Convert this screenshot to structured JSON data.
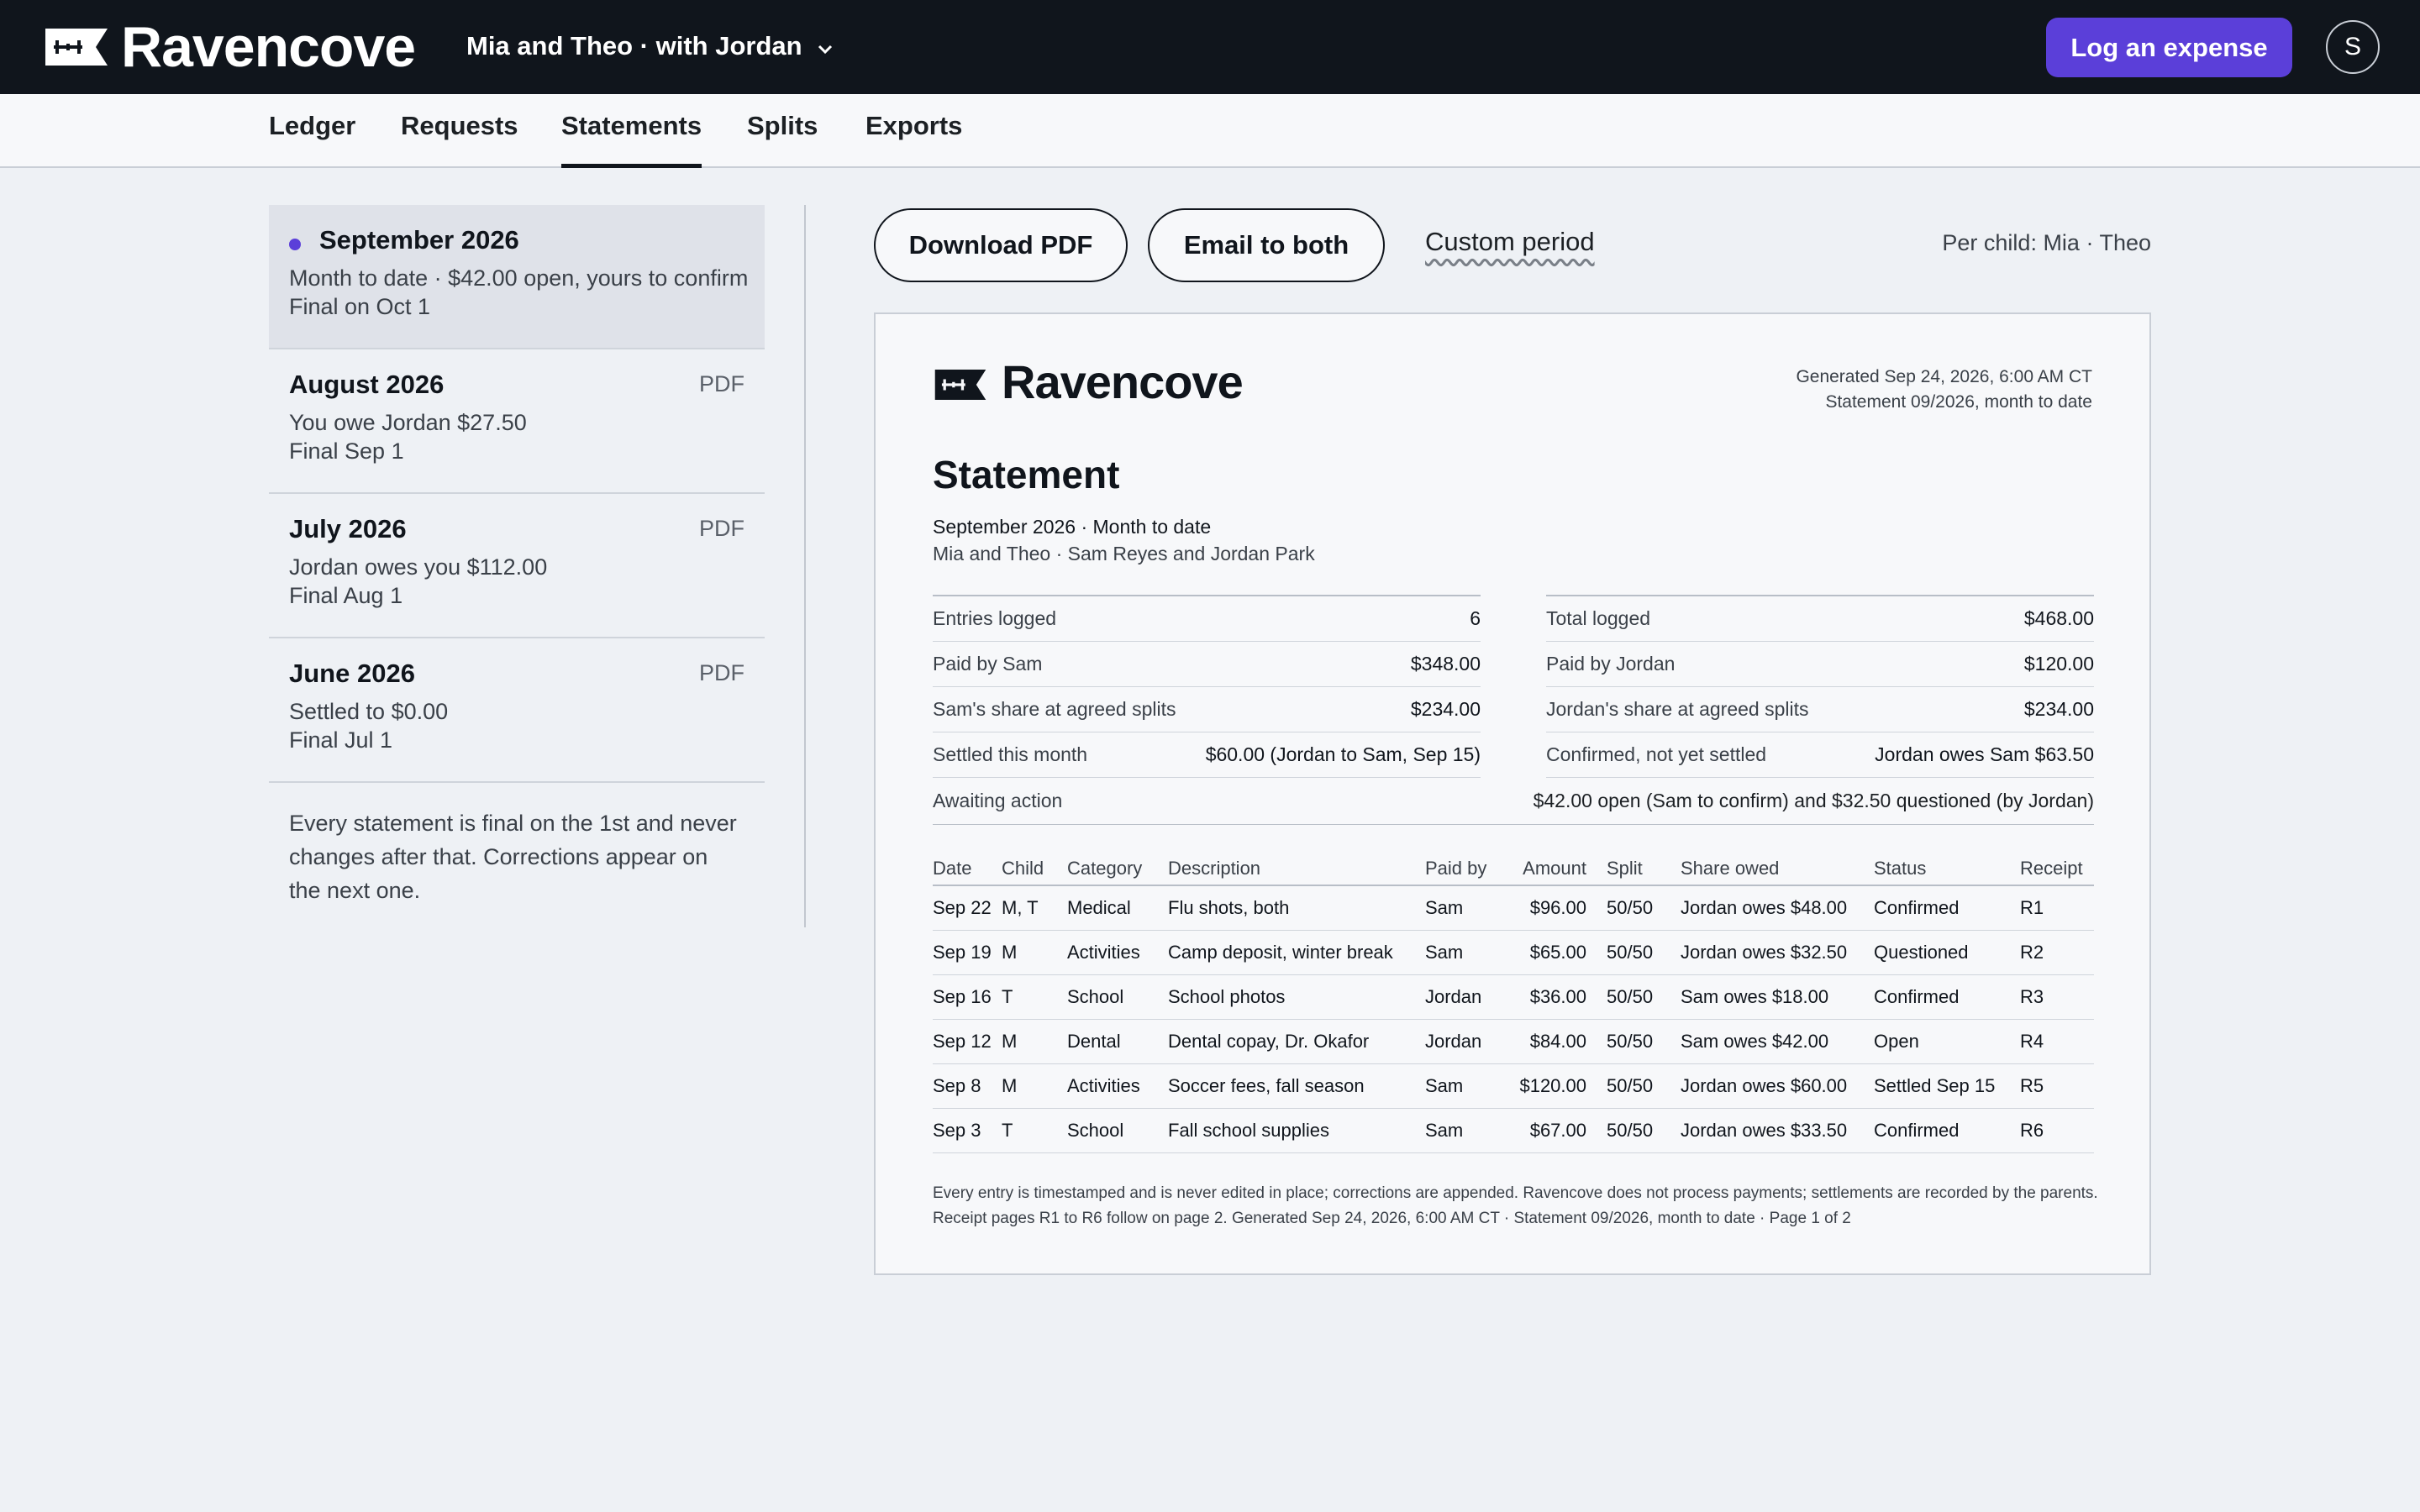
{
  "app": {
    "brand": "Ravencove"
  },
  "header": {
    "group_label": "Mia and Theo · with Jordan",
    "cta_label": "Log an expense",
    "avatar_initial": "S"
  },
  "tabs": [
    {
      "label": "Ledger",
      "active": false
    },
    {
      "label": "Requests",
      "active": false
    },
    {
      "label": "Statements",
      "active": true
    },
    {
      "label": "Splits",
      "active": false
    },
    {
      "label": "Exports",
      "active": false
    }
  ],
  "statements": [
    {
      "title": "September 2026",
      "line1": "Month to date · $42.00 open, yours to confirm",
      "line2": "Final on Oct 1",
      "tag": "",
      "active": true
    },
    {
      "title": "August 2026",
      "line1": "You owe Jordan $27.50",
      "line2": "Final Sep 1",
      "tag": "PDF",
      "active": false
    },
    {
      "title": "July 2026",
      "line1": "Jordan owes you $112.00",
      "line2": "Final Aug 1",
      "tag": "PDF",
      "active": false
    },
    {
      "title": "June 2026",
      "line1": "Settled to $0.00",
      "line2": "Final Jul 1",
      "tag": "PDF",
      "active": false
    }
  ],
  "statements_note": "Every statement is final on the 1st and never changes after that. Corrections appear on the next one.",
  "actions": {
    "download_label": "Download PDF",
    "email_label": "Email to both",
    "custom_period_label": "Custom period",
    "per_child_label": "Per child: Mia · Theo"
  },
  "document": {
    "brand": "Ravencove",
    "generated_line": "Generated Sep 24, 2026, 6:00 AM CT",
    "statement_line": "Statement 09/2026, month to date",
    "heading": "Statement",
    "period_line": "September 2026 · Month to date",
    "parties_line": "Mia and Theo · Sam Reyes and Jordan Park",
    "summary_left": [
      {
        "k": "Entries logged",
        "v": "6"
      },
      {
        "k": "Paid by Sam",
        "v": "$348.00"
      },
      {
        "k": "Sam's share at agreed splits",
        "v": "$234.00"
      },
      {
        "k": "Settled this month",
        "v": "$60.00 (Jordan to Sam, Sep 15)"
      }
    ],
    "summary_right": [
      {
        "k": "Total logged",
        "v": "$468.00"
      },
      {
        "k": "Paid by Jordan",
        "v": "$120.00"
      },
      {
        "k": "Jordan's share at agreed splits",
        "v": "$234.00"
      },
      {
        "k": "Confirmed, not yet settled",
        "v": "Jordan owes Sam $63.50"
      }
    ],
    "awaiting": {
      "k": "Awaiting action",
      "v": "$42.00 open (Sam to confirm) and $32.50 questioned (by Jordan)"
    },
    "columns": [
      "Date",
      "Child",
      "Category",
      "Description",
      "Paid by",
      "Amount",
      "Split",
      "Share owed",
      "Status",
      "Receipt"
    ],
    "rows": [
      [
        "Sep 22",
        "M, T",
        "Medical",
        "Flu shots, both",
        "Sam",
        "$96.00",
        "50/50",
        "Jordan owes $48.00",
        "Confirmed",
        "R1"
      ],
      [
        "Sep 19",
        "M",
        "Activities",
        "Camp deposit, winter break",
        "Sam",
        "$65.00",
        "50/50",
        "Jordan owes $32.50",
        "Questioned",
        "R2"
      ],
      [
        "Sep 16",
        "T",
        "School",
        "School photos",
        "Jordan",
        "$36.00",
        "50/50",
        "Sam owes $18.00",
        "Confirmed",
        "R3"
      ],
      [
        "Sep 12",
        "M",
        "Dental",
        "Dental copay, Dr. Okafor",
        "Jordan",
        "$84.00",
        "50/50",
        "Sam owes $42.00",
        "Open",
        "R4"
      ],
      [
        "Sep 8",
        "M",
        "Activities",
        "Soccer fees, fall season",
        "Sam",
        "$120.00",
        "50/50",
        "Jordan owes $60.00",
        "Settled Sep 15",
        "R5"
      ],
      [
        "Sep 3",
        "T",
        "School",
        "Fall school supplies",
        "Sam",
        "$67.00",
        "50/50",
        "Jordan owes $33.50",
        "Confirmed",
        "R6"
      ]
    ],
    "footnote": "Every entry is timestamped and is never edited in place; corrections are appended. Ravencove does not process payments; settlements are recorded by the parents. Receipt pages R1 to R6 follow on page 2. Generated Sep 24, 2026, 6:00 AM CT · Statement 09/2026, month to date · Page 1 of 2"
  },
  "colors": {
    "topbar": "#10151c",
    "accent": "#5b3fd9",
    "page_bg": "#eef1f5"
  }
}
